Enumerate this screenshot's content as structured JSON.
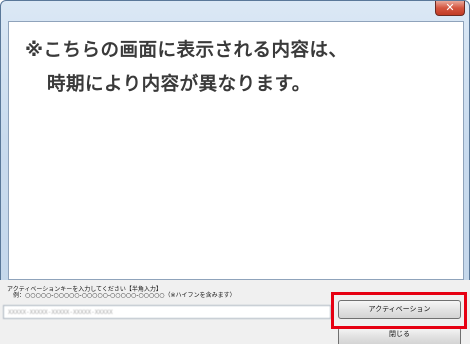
{
  "titlebar": {
    "close_glyph": "✕"
  },
  "content": {
    "notice_line1": "※こちらの画面に表示される内容は、",
    "notice_line2": "時期により内容が異なります。"
  },
  "activation": {
    "instruction": "アクティベーションキーを入力してください【半角入力】",
    "example": "例：○○○○○-○○○○○-○○○○○-○○○○○-○○○○○（※ハイフンを含みます）",
    "key_value": "XXXXX-XXXXX-XXXXX-XXXXX-XXXXX",
    "activate_button_label": "アクティベーション",
    "close_button_label": "閉じる"
  },
  "colors": {
    "highlight": "#e60012",
    "window_frame": "#c9dbee"
  },
  "icons": {
    "close": "close-icon"
  }
}
